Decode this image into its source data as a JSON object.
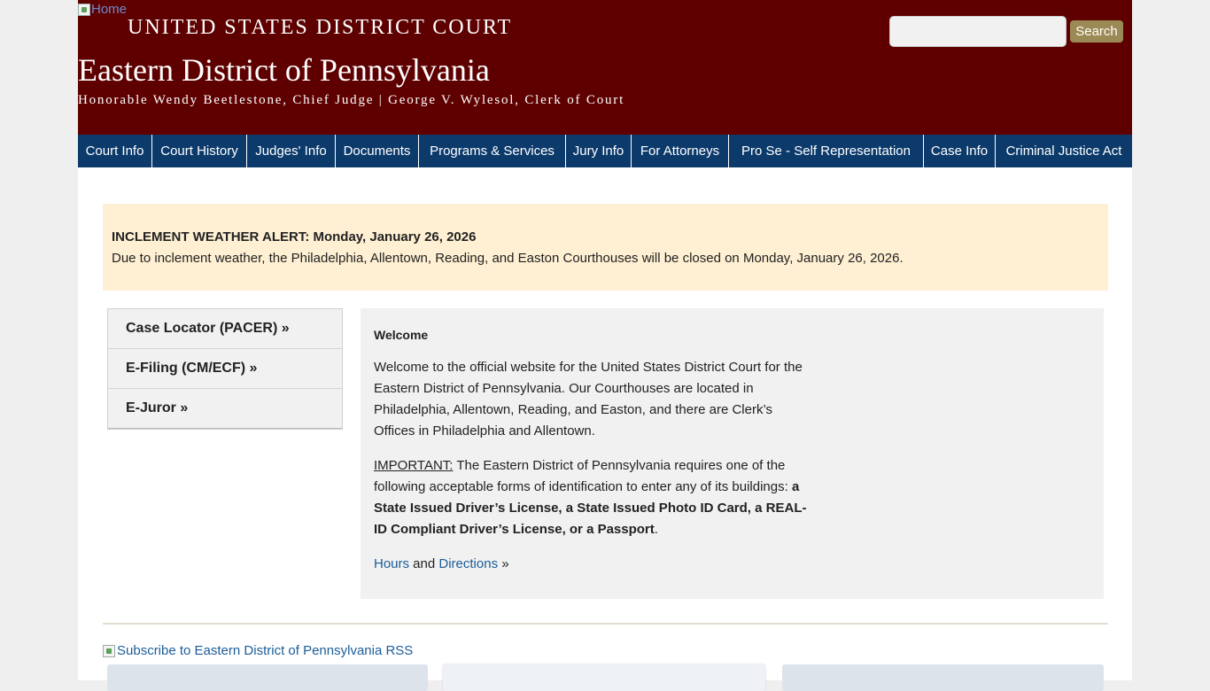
{
  "header": {
    "home_alt": "Home",
    "title_line1": "UNITED STATES DISTRICT COURT",
    "title_line2": "Eastern District of Pennsylvania",
    "title_line3": "Honorable Wendy Beetlestone, Chief Judge | George V. Wylesol, Clerk of Court",
    "search_value": "",
    "search_button": "Search"
  },
  "nav": {
    "items": [
      {
        "label": "Court Info"
      },
      {
        "label": "Court History"
      },
      {
        "label": "Judges' Info"
      },
      {
        "label": "Documents"
      },
      {
        "label": "Programs & Services"
      },
      {
        "label": "Jury Info"
      },
      {
        "label": "For Attorneys"
      },
      {
        "label": "Pro Se - Self Representation"
      },
      {
        "label": "Case Info"
      },
      {
        "label": "Criminal Justice Act"
      }
    ]
  },
  "alert": {
    "title": "INCLEMENT WEATHER ALERT: Monday, January 26, 2026",
    "body": "Due to inclement weather, the Philadelphia, Allentown, Reading, and Easton Courthouses will be closed on Monday, January 26, 2026."
  },
  "side_menu": {
    "items": [
      {
        "label": "Case Locator (PACER) »"
      },
      {
        "label": "E-Filing (CM/ECF) »"
      },
      {
        "label": "E-Juror »"
      }
    ]
  },
  "welcome": {
    "heading": "Welcome",
    "para1": "Welcome to the official website for the United States District Court for the Eastern District of Pennsylvania. Our Courthouses are located in Philadelphia, Allentown, Reading, and Easton, and there are Clerk’s Offices in Philadelphia and Allentown.",
    "important_label": "IMPORTANT:",
    "para2_text": " The Eastern District of Pennsylvania requires one of the following acceptable forms of identification to enter any of its buildings: ",
    "para2_bold": "a State Issued Driver’s License, a State Issued Photo ID Card, a REAL-ID Compliant Driver’s License, or a Passport",
    "para2_end": ".",
    "hours_link": "Hours",
    "and_text": " and ",
    "directions_link": "Directions",
    "arrow": " »"
  },
  "footer": {
    "rss_alt": "Subscribe to Eastern District of Pennsylvania RSS"
  }
}
